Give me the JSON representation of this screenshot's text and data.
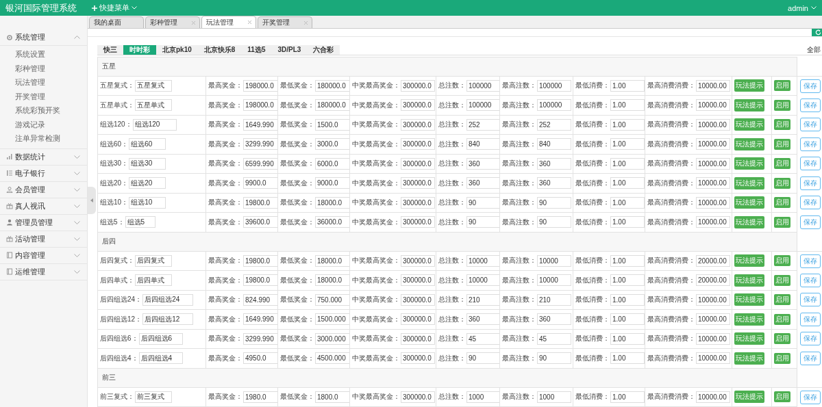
{
  "header": {
    "title": "银河国际管理系统",
    "quick_menu": "快捷菜单",
    "user": "admin"
  },
  "page_tabs": [
    {
      "label": "我的桌面",
      "closable": false,
      "selected": false
    },
    {
      "label": "彩种管理",
      "closable": true,
      "selected": false
    },
    {
      "label": "玩法管理",
      "closable": true,
      "selected": true
    },
    {
      "label": "开奖管理",
      "closable": true,
      "selected": false
    }
  ],
  "sidebar": {
    "items": [
      {
        "label": "系统管理",
        "expanded": true,
        "children": [
          {
            "label": "系统设置"
          },
          {
            "label": "彩种管理"
          },
          {
            "label": "玩法管理"
          },
          {
            "label": "开奖管理"
          },
          {
            "label": "系统彩预开奖"
          },
          {
            "label": "游戏记录"
          },
          {
            "label": "注单异常检测"
          }
        ]
      },
      {
        "label": "数据统计",
        "expanded": false
      },
      {
        "label": "电子银行",
        "expanded": false
      },
      {
        "label": "会员管理",
        "expanded": false
      },
      {
        "label": "真人视讯",
        "expanded": false
      },
      {
        "label": "管理员管理",
        "expanded": false
      },
      {
        "label": "活动管理",
        "expanded": false
      },
      {
        "label": "内容管理",
        "expanded": false
      },
      {
        "label": "运维管理",
        "expanded": false
      }
    ]
  },
  "game_tabs": [
    {
      "label": "快三",
      "selected": false
    },
    {
      "label": "时时彩",
      "selected": true
    },
    {
      "label": "北京pk10",
      "selected": false
    },
    {
      "label": "北京快乐8",
      "selected": false
    },
    {
      "label": "11选5",
      "selected": false
    },
    {
      "label": "3D/PL3",
      "selected": false
    },
    {
      "label": "六合彩",
      "selected": false
    }
  ],
  "filter_label": "全部",
  "sections": [
    {
      "title": "五星",
      "rows": [
        {
          "name": [
            "五星复式：",
            "五星复式"
          ],
          "fields": [
            [
              "最高奖金：",
              "198000.0"
            ],
            [
              "最低奖金：",
              "180000.0"
            ],
            [
              "中奖最高奖金：",
              "300000.0"
            ],
            [
              "总注数：",
              "100000"
            ],
            [
              "最高注数：",
              "100000"
            ],
            [
              "最低消费：",
              "1.00"
            ],
            [
              "最高消费消费：",
              "10000.00"
            ]
          ],
          "buttons": [
            "玩法提示",
            "启用",
            "保存"
          ]
        },
        {
          "name": [
            "五星单式：",
            "五星单式"
          ],
          "fields": [
            [
              "最高奖金：",
              "198000.0"
            ],
            [
              "最低奖金：",
              "180000.0"
            ],
            [
              "中奖最高奖金：",
              "300000.0"
            ],
            [
              "总注数：",
              "100000"
            ],
            [
              "最高注数：",
              "100000"
            ],
            [
              "最低消费：",
              "1.00"
            ],
            [
              "最高消费消费：",
              "10000.00"
            ]
          ],
          "buttons": [
            "玩法提示",
            "启用",
            "保存"
          ]
        },
        {
          "name": [
            "组选120：",
            "组选120"
          ],
          "fields": [
            [
              "最高奖金：",
              "1649.990"
            ],
            [
              "最低奖金：",
              "1500.0"
            ],
            [
              "中奖最高奖金：",
              "300000.0"
            ],
            [
              "总注数：",
              "252"
            ],
            [
              "最高注数：",
              "252"
            ],
            [
              "最低消费：",
              "1.00"
            ],
            [
              "最高消费消费：",
              "10000.00"
            ]
          ],
          "buttons": [
            "玩法提示",
            "启用",
            "保存"
          ]
        },
        {
          "name": [
            "组选60：",
            "组选60"
          ],
          "fields": [
            [
              "最高奖金：",
              "3299.990"
            ],
            [
              "最低奖金：",
              "3000.0"
            ],
            [
              "中奖最高奖金：",
              "300000.0"
            ],
            [
              "总注数：",
              "840"
            ],
            [
              "最高注数：",
              "840"
            ],
            [
              "最低消费：",
              "1.00"
            ],
            [
              "最高消费消费：",
              "10000.00"
            ]
          ],
          "buttons": [
            "玩法提示",
            "启用",
            "保存"
          ]
        },
        {
          "name": [
            "组选30：",
            "组选30"
          ],
          "fields": [
            [
              "最高奖金：",
              "6599.990"
            ],
            [
              "最低奖金：",
              "6000.0"
            ],
            [
              "中奖最高奖金：",
              "300000.0"
            ],
            [
              "总注数：",
              "360"
            ],
            [
              "最高注数：",
              "360"
            ],
            [
              "最低消费：",
              "1.00"
            ],
            [
              "最高消费消费：",
              "10000.00"
            ]
          ],
          "buttons": [
            "玩法提示",
            "启用",
            "保存"
          ]
        },
        {
          "name": [
            "组选20：",
            "组选20"
          ],
          "fields": [
            [
              "最高奖金：",
              "9900.0"
            ],
            [
              "最低奖金：",
              "9000.0"
            ],
            [
              "中奖最高奖金：",
              "300000.0"
            ],
            [
              "总注数：",
              "360"
            ],
            [
              "最高注数：",
              "360"
            ],
            [
              "最低消费：",
              "1.00"
            ],
            [
              "最高消费消费：",
              "10000.00"
            ]
          ],
          "buttons": [
            "玩法提示",
            "启用",
            "保存"
          ]
        },
        {
          "name": [
            "组选10：",
            "组选10"
          ],
          "fields": [
            [
              "最高奖金：",
              "19800.0"
            ],
            [
              "最低奖金：",
              "18000.0"
            ],
            [
              "中奖最高奖金：",
              "300000.0"
            ],
            [
              "总注数：",
              "90"
            ],
            [
              "最高注数：",
              "90"
            ],
            [
              "最低消费：",
              "1.00"
            ],
            [
              "最高消费消费：",
              "10000.00"
            ]
          ],
          "buttons": [
            "玩法提示",
            "启用",
            "保存"
          ]
        },
        {
          "name": [
            "组选5：",
            "组选5"
          ],
          "fields": [
            [
              "最高奖金：",
              "39600.0"
            ],
            [
              "最低奖金：",
              "36000.0"
            ],
            [
              "中奖最高奖金：",
              "300000.0"
            ],
            [
              "总注数：",
              "90"
            ],
            [
              "最高注数：",
              "90"
            ],
            [
              "最低消费：",
              "1.00"
            ],
            [
              "最高消费消费：",
              "10000.00"
            ]
          ],
          "buttons": [
            "玩法提示",
            "启用",
            "保存"
          ]
        }
      ]
    },
    {
      "title": "后四",
      "rows": [
        {
          "name": [
            "后四复式：",
            "后四复式"
          ],
          "fields": [
            [
              "最高奖金：",
              "19800.0"
            ],
            [
              "最低奖金：",
              "18000.0"
            ],
            [
              "中奖最高奖金：",
              "300000.0"
            ],
            [
              "总注数：",
              "10000"
            ],
            [
              "最高注数：",
              "10000"
            ],
            [
              "最低消费：",
              "1.00"
            ],
            [
              "最高消费消费：",
              "20000.00"
            ]
          ],
          "buttons": [
            "玩法提示",
            "启用",
            "保存"
          ]
        },
        {
          "name": [
            "后四单式：",
            "后四单式"
          ],
          "fields": [
            [
              "最高奖金：",
              "19800.0"
            ],
            [
              "最低奖金：",
              "18000.0"
            ],
            [
              "中奖最高奖金：",
              "300000.0"
            ],
            [
              "总注数：",
              "10000"
            ],
            [
              "最高注数：",
              "10000"
            ],
            [
              "最低消费：",
              "1.00"
            ],
            [
              "最高消费消费：",
              "20000.00"
            ]
          ],
          "buttons": [
            "玩法提示",
            "启用",
            "保存"
          ]
        },
        {
          "name": [
            "后四组选24：",
            "后四组选24"
          ],
          "fields": [
            [
              "最高奖金：",
              "824.990"
            ],
            [
              "最低奖金：",
              "750.000"
            ],
            [
              "中奖最高奖金：",
              "300000.0"
            ],
            [
              "总注数：",
              "210"
            ],
            [
              "最高注数：",
              "210"
            ],
            [
              "最低消费：",
              "1.00"
            ],
            [
              "最高消费消费：",
              "10000.00"
            ]
          ],
          "buttons": [
            "玩法提示",
            "启用",
            "保存"
          ]
        },
        {
          "name": [
            "后四组选12：",
            "后四组选12"
          ],
          "fields": [
            [
              "最高奖金：",
              "1649.990"
            ],
            [
              "最低奖金：",
              "1500.000"
            ],
            [
              "中奖最高奖金：",
              "300000.0"
            ],
            [
              "总注数：",
              "360"
            ],
            [
              "最高注数：",
              "360"
            ],
            [
              "最低消费：",
              "1.00"
            ],
            [
              "最高消费消费：",
              "10000.00"
            ]
          ],
          "buttons": [
            "玩法提示",
            "启用",
            "保存"
          ]
        },
        {
          "name": [
            "后四组选6：",
            "后四组选6"
          ],
          "fields": [
            [
              "最高奖金：",
              "3299.990"
            ],
            [
              "最低奖金：",
              "3000.000"
            ],
            [
              "中奖最高奖金：",
              "300000.0"
            ],
            [
              "总注数：",
              "45"
            ],
            [
              "最高注数：",
              "45"
            ],
            [
              "最低消费：",
              "1.00"
            ],
            [
              "最高消费消费：",
              "10000.00"
            ]
          ],
          "buttons": [
            "玩法提示",
            "启用",
            "保存"
          ]
        },
        {
          "name": [
            "后四组选4：",
            "后四组选4"
          ],
          "fields": [
            [
              "最高奖金：",
              "4950.0"
            ],
            [
              "最低奖金：",
              "4500.000"
            ],
            [
              "中奖最高奖金：",
              "300000.0"
            ],
            [
              "总注数：",
              "90"
            ],
            [
              "最高注数：",
              "90"
            ],
            [
              "最低消费：",
              "1.00"
            ],
            [
              "最高消费消费：",
              "10000.00"
            ]
          ],
          "buttons": [
            "玩法提示",
            "启用",
            "保存"
          ]
        }
      ]
    },
    {
      "title": "前三",
      "rows": [
        {
          "name": [
            "前三复式：",
            "前三复式"
          ],
          "fields": [
            [
              "最高奖金：",
              "1980.0"
            ],
            [
              "最低奖金：",
              "1800.0"
            ],
            [
              "中奖最高奖金：",
              "300000.0"
            ],
            [
              "总注数：",
              "1000"
            ],
            [
              "最高注数：",
              "1000"
            ],
            [
              "最低消费：",
              "1.00"
            ],
            [
              "最高消费消费：",
              "10000.00"
            ]
          ],
          "buttons": [
            "玩法提示",
            "启用",
            "保存"
          ]
        }
      ]
    }
  ]
}
